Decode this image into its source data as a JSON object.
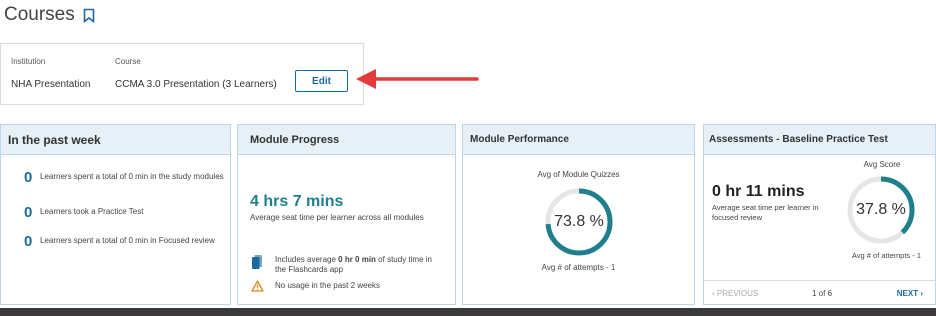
{
  "header": {
    "title": "Courses",
    "bookmark_icon": "bookmark-icon"
  },
  "course_box": {
    "institution_label": "Institution",
    "course_label": "Course",
    "institution": "NHA Presentation",
    "course": "CCMA 3.0 Presentation (3 Learners)",
    "edit_label": "Edit"
  },
  "annotation": {
    "arrow_color": "#e23b3b"
  },
  "past_week": {
    "title": "In the past week",
    "stats": [
      {
        "count": "0",
        "text": "Learners spent a total of 0 min in the study modules"
      },
      {
        "count": "0",
        "text": "Learners took a Practice Test"
      },
      {
        "count": "0",
        "text": "Learners spent a total of 0 min in Focused review"
      }
    ]
  },
  "module_progress": {
    "title": "Module Progress",
    "time": "4 hrs 7 mins",
    "subtitle": "Average seat time per learner across all modules",
    "flashcards_pre": "Includes average ",
    "flashcards_bold": "0 hr 0 min",
    "flashcards_post": " of study time in the Flashcards app",
    "warning": "No usage in the past 2 weeks"
  },
  "module_performance": {
    "title": "Module Performance",
    "label": "Avg of Module Quizzes",
    "value": "73.8 %",
    "percent": 73.8,
    "attempts": "Avg # of attempts - 1"
  },
  "assessments": {
    "title": "Assessments - Baseline Practice Test",
    "time": "0 hr 11 mins",
    "subtitle": "Average seat time per learner in focused review",
    "score_label": "Avg Score",
    "value": "37.8 %",
    "percent": 37.8,
    "attempts": "Avg # of attempts - 1",
    "prev": "PREVIOUS",
    "page": "1 of 6",
    "next": "NEXT"
  },
  "colors": {
    "accent": "#1a6aa0",
    "teal": "#1f7f8c",
    "ring_bg": "#e6e6e6",
    "warning": "#e08a1e"
  }
}
